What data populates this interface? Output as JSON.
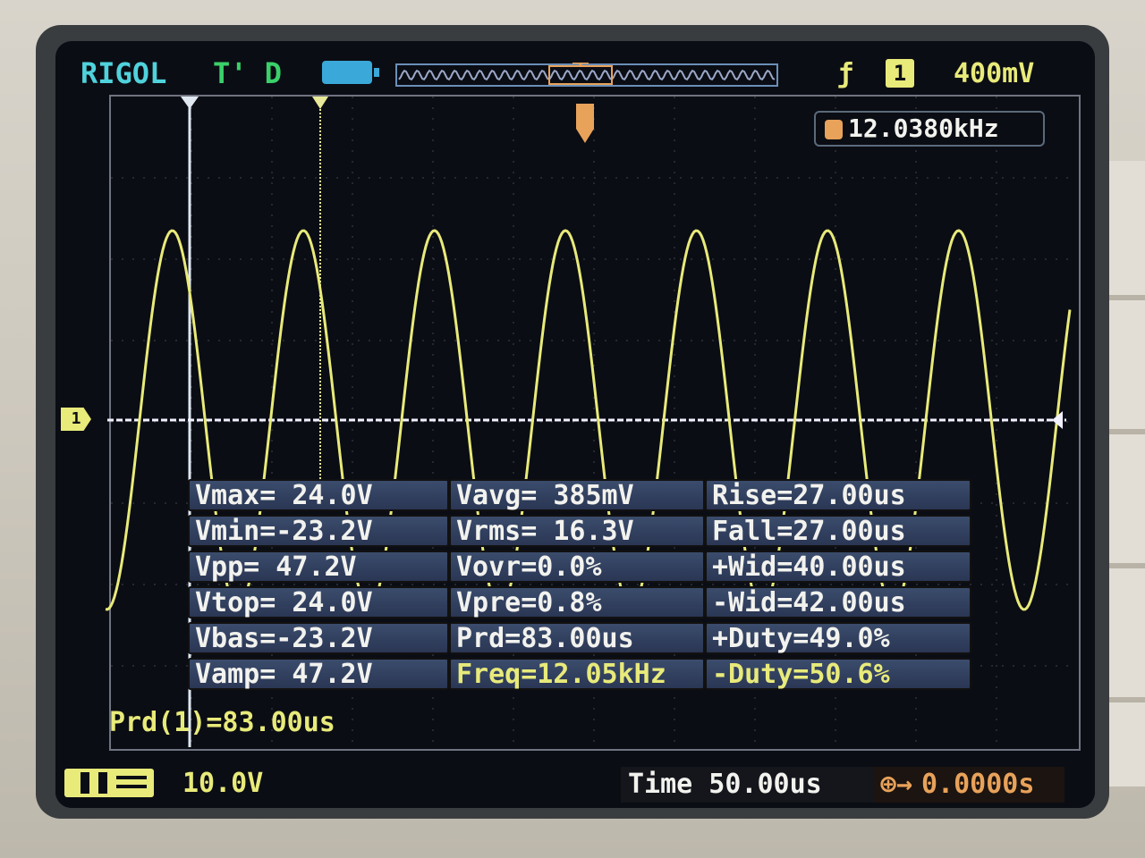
{
  "header": {
    "brand": "RIGOL",
    "trigger_status": "T' D",
    "channel_number": "1",
    "volts_per_div": "400mV"
  },
  "counter": {
    "frequency": "12.0380kHz"
  },
  "measurements": {
    "rows": [
      [
        "Vmax= 24.0V",
        "Vavg= 385mV",
        "Rise=27.00us"
      ],
      [
        "Vmin=-23.2V",
        "Vrms= 16.3V",
        "Fall=27.00us"
      ],
      [
        "Vpp= 47.2V",
        "Vovr=0.0%",
        "+Wid=40.00us"
      ],
      [
        "Vtop= 24.0V",
        "Vpre=0.8%",
        "-Wid=42.00us"
      ],
      [
        "Vbas=-23.2V",
        "Prd=83.00us",
        "+Duty=49.0%"
      ],
      [
        "Vamp= 47.2V",
        "Freq=12.05kHz",
        "-Duty=50.6%"
      ]
    ]
  },
  "cursor_readout": "Prd(1)=83.00us",
  "bottom": {
    "ch1_scale": "10.0V",
    "timebase": "Time 50.00us",
    "trigger_offset": "0.0000s"
  },
  "colors": {
    "trace": "#e8ea7a",
    "brand": "#4fd2dc",
    "trigger": "#e8a25a",
    "table_bg": "#2f3c5c"
  },
  "icons": {
    "battery": "memory-depth-icon",
    "trigger_edge": "rising-edge-icon",
    "trigger_marker": "trigger-position-icon"
  }
}
